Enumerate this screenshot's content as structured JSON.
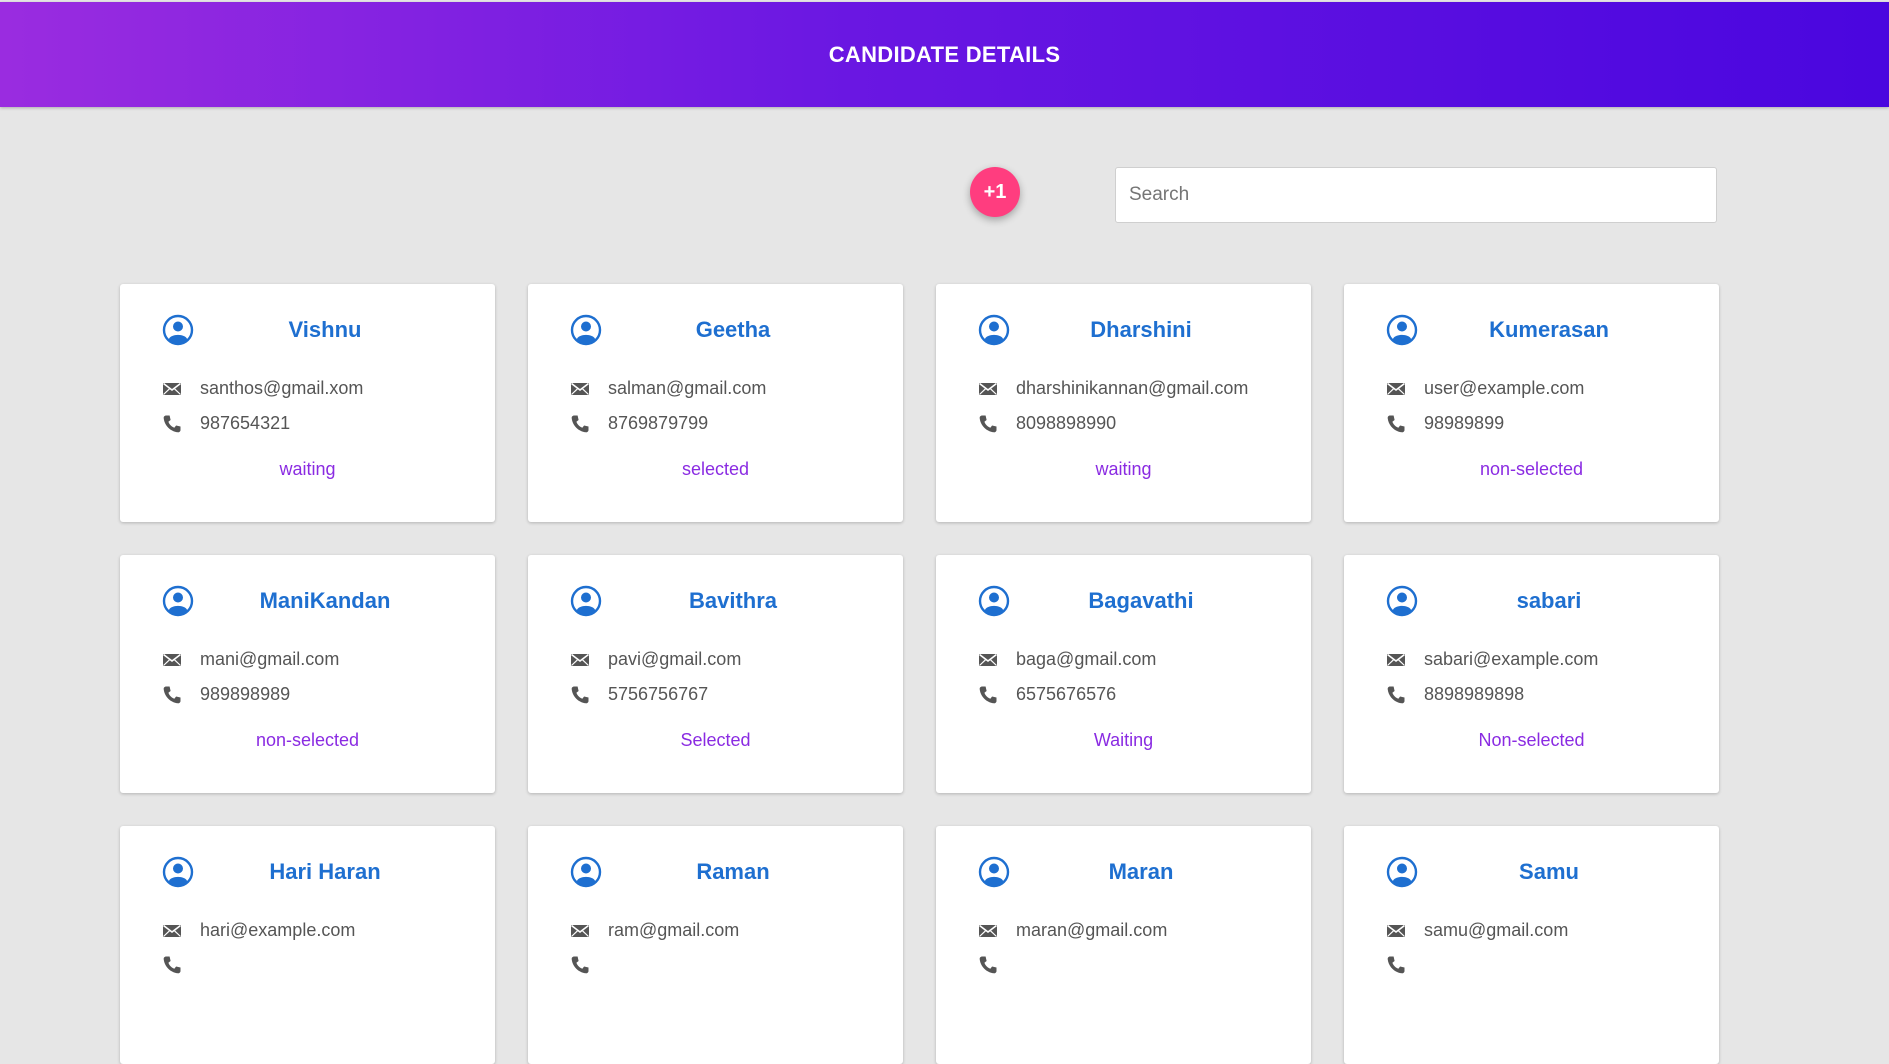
{
  "header": {
    "title": "CANDIDATE DETAILS"
  },
  "actions": {
    "add_label": "+1"
  },
  "search": {
    "placeholder": "Search",
    "value": ""
  },
  "colors": {
    "header_start": "#9a2ce0",
    "header_end": "#4a06df",
    "fab": "#ff3d7f",
    "name": "#1e6fd0",
    "status": "#8a2be2"
  },
  "candidates": [
    {
      "name": "Vishnu",
      "email": "santhos@gmail.xom",
      "phone": "987654321",
      "status": "waiting"
    },
    {
      "name": "Geetha",
      "email": "salman@gmail.com",
      "phone": "8769879799",
      "status": "selected"
    },
    {
      "name": "Dharshini",
      "email": "dharshinikannan@gmail.com",
      "phone": "8098898990",
      "status": "waiting"
    },
    {
      "name": "Kumerasan",
      "email": "user@example.com",
      "phone": "98989899",
      "status": "non-selected"
    },
    {
      "name": "ManiKandan",
      "email": "mani@gmail.com",
      "phone": "989898989",
      "status": "non-selected"
    },
    {
      "name": "Bavithra",
      "email": "pavi@gmail.com",
      "phone": "5756756767",
      "status": "Selected"
    },
    {
      "name": "Bagavathi",
      "email": "baga@gmail.com",
      "phone": "6575676576",
      "status": "Waiting"
    },
    {
      "name": "sabari",
      "email": "sabari@example.com",
      "phone": "8898989898",
      "status": "Non-selected"
    },
    {
      "name": "Hari Haran",
      "email": "hari@example.com",
      "phone": "",
      "status": ""
    },
    {
      "name": "Raman",
      "email": "ram@gmail.com",
      "phone": "",
      "status": ""
    },
    {
      "name": "Maran",
      "email": "maran@gmail.com",
      "phone": "",
      "status": ""
    },
    {
      "name": "Samu",
      "email": "samu@gmail.com",
      "phone": "",
      "status": ""
    }
  ],
  "icons": {
    "avatar": "account-circle-icon",
    "email": "envelope-icon",
    "phone": "phone-icon"
  }
}
